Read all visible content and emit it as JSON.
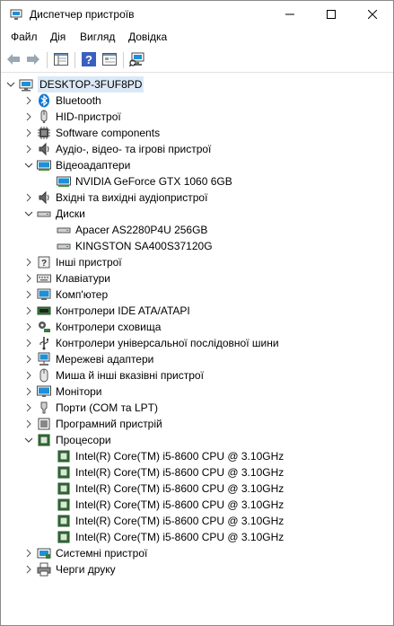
{
  "window": {
    "title": "Диспетчер пристроїв"
  },
  "menu": [
    "Файл",
    "Дія",
    "Вигляд",
    "Довідка"
  ],
  "tree": {
    "root": "DESKTOP-3FUF8PD",
    "categories": [
      {
        "label": "Bluetooth",
        "icon": "bluetooth-icon",
        "expanded": false
      },
      {
        "label": "HID-пристрої",
        "icon": "hid-icon",
        "expanded": false
      },
      {
        "label": "Software components",
        "icon": "software-component-icon",
        "expanded": false
      },
      {
        "label": "Аудіо-, відео- та ігрові пристрої",
        "icon": "speaker-icon",
        "expanded": false
      },
      {
        "label": "Відеоадаптери",
        "icon": "display-adapter-icon",
        "expanded": true,
        "children": [
          "NVIDIA GeForce GTX 1060 6GB"
        ]
      },
      {
        "label": "Вхідні та вихідні аудіопристрої",
        "icon": "speaker-icon",
        "expanded": false
      },
      {
        "label": "Диски",
        "icon": "disk-icon",
        "expanded": true,
        "children": [
          "Apacer AS2280P4U 256GB",
          "KINGSTON SA400S37120G"
        ]
      },
      {
        "label": "Інші пристрої",
        "icon": "unknown-device-icon",
        "expanded": false
      },
      {
        "label": "Клавіатури",
        "icon": "keyboard-icon",
        "expanded": false
      },
      {
        "label": "Комп'ютер",
        "icon": "computer-icon",
        "expanded": false
      },
      {
        "label": "Контролери IDE ATA/ATAPI",
        "icon": "ide-controller-icon",
        "expanded": false
      },
      {
        "label": "Контролери сховища",
        "icon": "storage-controller-icon",
        "expanded": false
      },
      {
        "label": "Контролери універсальної послідовної шини",
        "icon": "usb-icon",
        "expanded": false
      },
      {
        "label": "Мережеві адаптери",
        "icon": "network-adapter-icon",
        "expanded": false
      },
      {
        "label": "Миша й інші вказівні пристрої",
        "icon": "mouse-icon",
        "expanded": false
      },
      {
        "label": "Монітори",
        "icon": "monitor-icon",
        "expanded": false
      },
      {
        "label": "Порти (COM та LPT)",
        "icon": "port-icon",
        "expanded": false
      },
      {
        "label": "Програмний пристрій",
        "icon": "software-device-icon",
        "expanded": false
      },
      {
        "label": "Процесори",
        "icon": "processor-icon",
        "expanded": true,
        "children": [
          "Intel(R) Core(TM) i5-8600 CPU @ 3.10GHz",
          "Intel(R) Core(TM) i5-8600 CPU @ 3.10GHz",
          "Intel(R) Core(TM) i5-8600 CPU @ 3.10GHz",
          "Intel(R) Core(TM) i5-8600 CPU @ 3.10GHz",
          "Intel(R) Core(TM) i5-8600 CPU @ 3.10GHz",
          "Intel(R) Core(TM) i5-8600 CPU @ 3.10GHz"
        ]
      },
      {
        "label": "Системні пристрої",
        "icon": "system-devices-icon",
        "expanded": false
      },
      {
        "label": "Черги друку",
        "icon": "printer-icon",
        "expanded": false
      }
    ]
  },
  "colors": {
    "root_highlight": "#dbe9f6",
    "monitor_blue": "#1e90d8",
    "chip_green": "#3c7a3c",
    "bluetooth_blue": "#1478d4"
  }
}
